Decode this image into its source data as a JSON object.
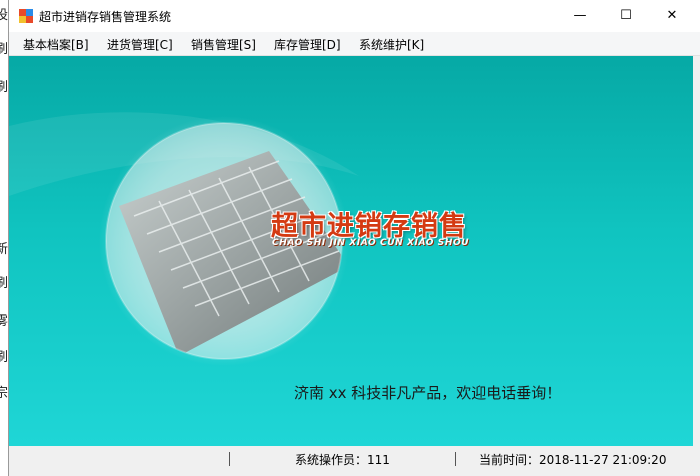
{
  "background_window": {
    "fragments": [
      "设",
      "刷",
      "刷",
      "新",
      "刷",
      "雾",
      "刷",
      "宗"
    ]
  },
  "window": {
    "title": "超市进销存销售管理系统",
    "controls": {
      "minimize": "—",
      "maximize": "☐",
      "close": "✕"
    }
  },
  "menu": {
    "items": [
      {
        "label": "基本档案[B]"
      },
      {
        "label": "进货管理[C]"
      },
      {
        "label": "销售管理[S]"
      },
      {
        "label": "库存管理[D]"
      },
      {
        "label": "系统维护[K]"
      }
    ]
  },
  "main": {
    "logo_title": "超市进销存销售",
    "logo_subtitle": "CHAO SHI JIN XIAO CUN XIAO SHOU",
    "footer": "济南 xx 科技非凡产品，欢迎电话垂询！"
  },
  "statusbar": {
    "operator": "系统操作员：111",
    "time": "当前时间：2018-11-27 21:09:20"
  },
  "colors": {
    "content_top": "#06a9a5",
    "content_bottom": "#1fd6d6",
    "logo_red": "#d43a12"
  }
}
